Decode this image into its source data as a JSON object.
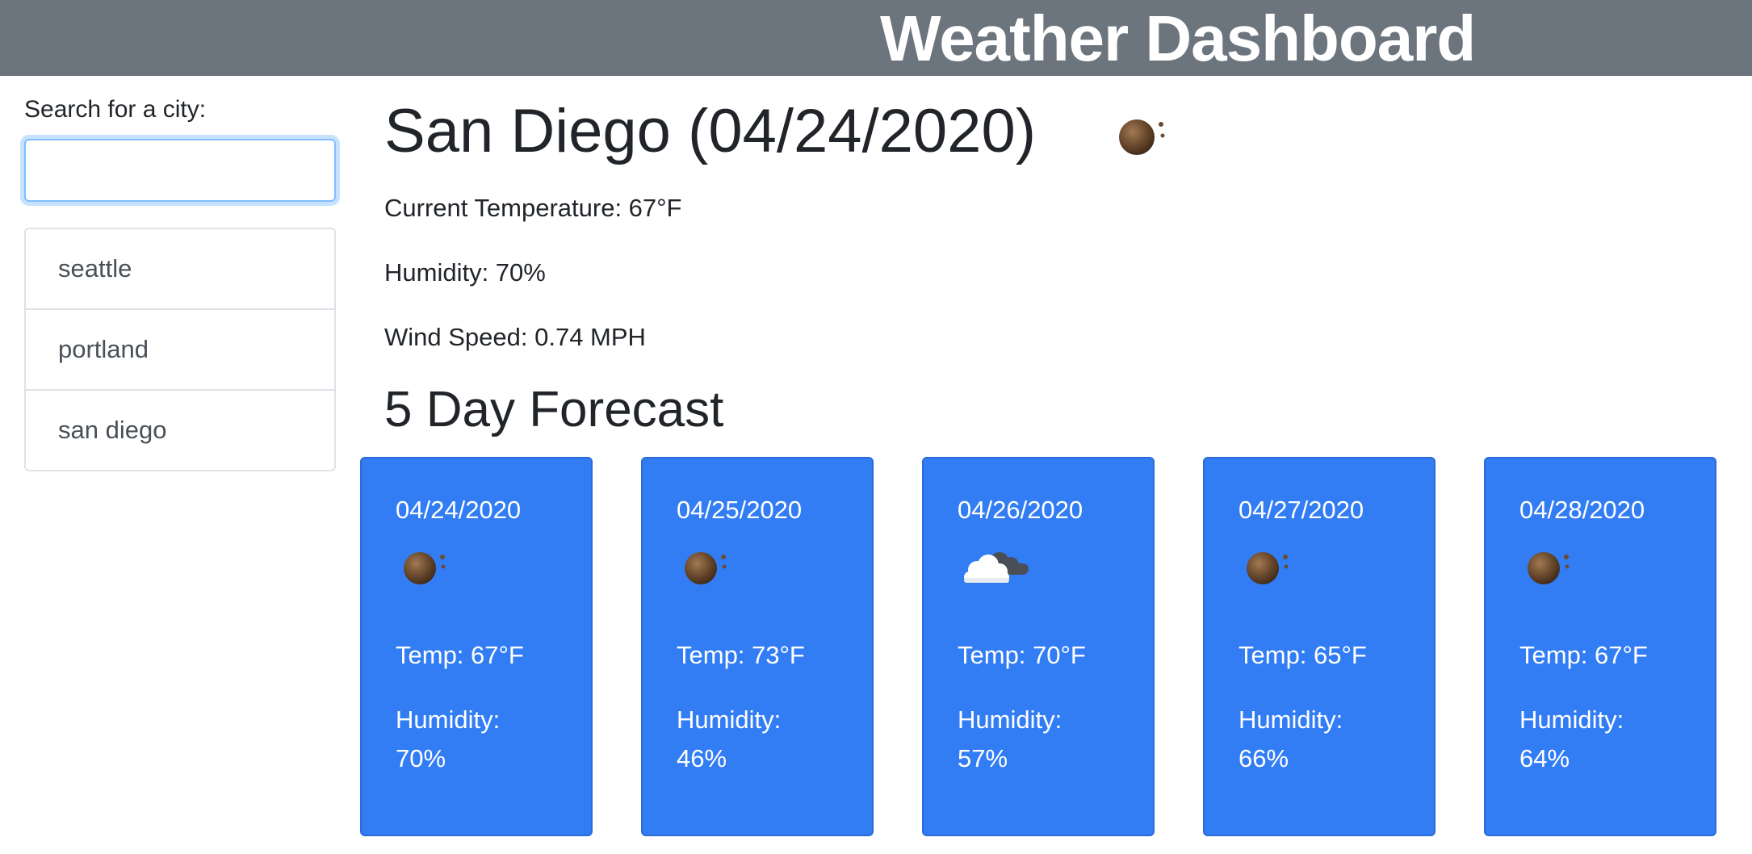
{
  "header": {
    "title": "Weather Dashboard"
  },
  "sidebar": {
    "search_label": "Search for a city:",
    "search_value": "",
    "search_placeholder": "",
    "history": [
      {
        "label": "seattle"
      },
      {
        "label": "portland"
      },
      {
        "label": "san diego"
      }
    ]
  },
  "current": {
    "city_title": "San Diego (04/24/2020)",
    "icon": "clear-night-moon-icon",
    "temperature": "Current Temperature: 67°F",
    "humidity": "Humidity: 70%",
    "wind": "Wind Speed: 0.74 MPH"
  },
  "forecast": {
    "heading": "5 Day Forecast",
    "humidity_label": "Humidity:",
    "days": [
      {
        "date": "04/24/2020",
        "icon": "clear-night-moon-icon",
        "temp": "Temp: 67°F",
        "humidity": "70%"
      },
      {
        "date": "04/25/2020",
        "icon": "clear-night-moon-icon",
        "temp": "Temp: 73°F",
        "humidity": "46%"
      },
      {
        "date": "04/26/2020",
        "icon": "cloudy-night-icon",
        "temp": "Temp: 70°F",
        "humidity": "57%"
      },
      {
        "date": "04/27/2020",
        "icon": "clear-night-moon-icon",
        "temp": "Temp: 65°F",
        "humidity": "66%"
      },
      {
        "date": "04/28/2020",
        "icon": "clear-night-moon-icon",
        "temp": "Temp: 67°F",
        "humidity": "64%"
      }
    ]
  },
  "colors": {
    "header_bg": "#6c757d",
    "card_bg": "#337df4",
    "moon": "#6b4a2e"
  }
}
